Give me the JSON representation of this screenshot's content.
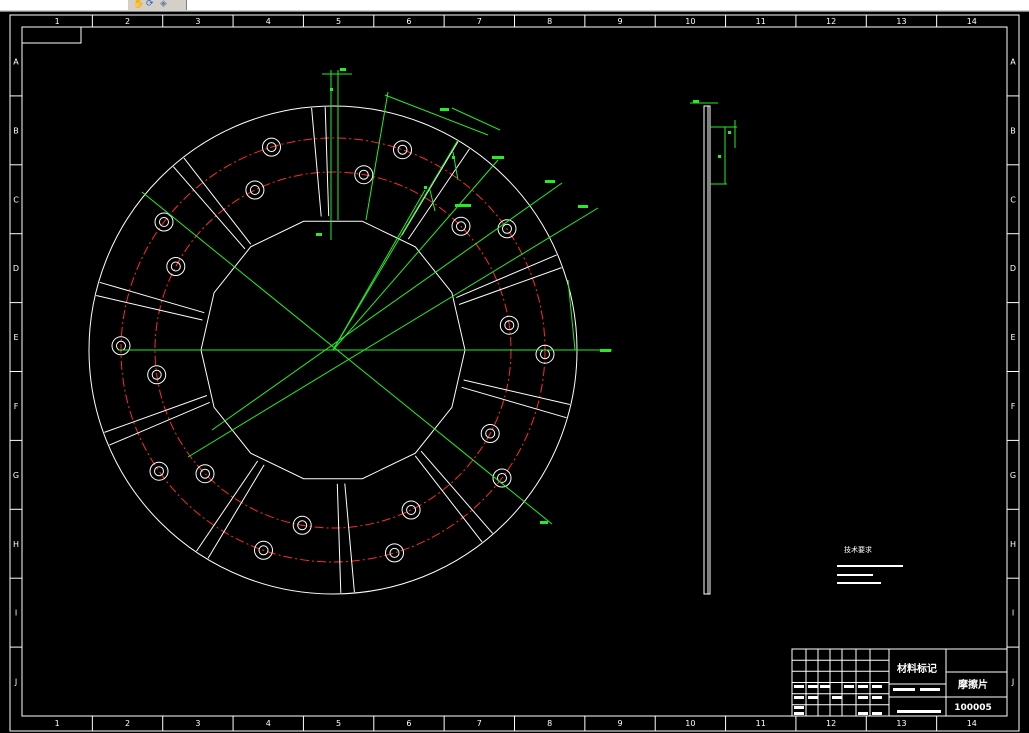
{
  "toolbar": {
    "icons": [
      "pan-icon",
      "refresh-icon",
      "layer-icon"
    ]
  },
  "sheet": {
    "col_labels": [
      "1",
      "2",
      "3",
      "4",
      "5",
      "6",
      "7",
      "8",
      "9",
      "10",
      "11",
      "12",
      "13",
      "14"
    ],
    "row_labels": [
      "A",
      "B",
      "C",
      "D",
      "E",
      "F",
      "G",
      "H",
      "I",
      "J"
    ]
  },
  "title_block": {
    "material_mark": "材料标记",
    "part_name": "摩擦片",
    "drawing_number": "100005"
  },
  "tech_notes": {
    "heading": "技术要求"
  },
  "colors": {
    "outline": "#ffffff",
    "centerline": "#ff2a2a",
    "dimension": "#22ee22",
    "background": "#000000"
  }
}
